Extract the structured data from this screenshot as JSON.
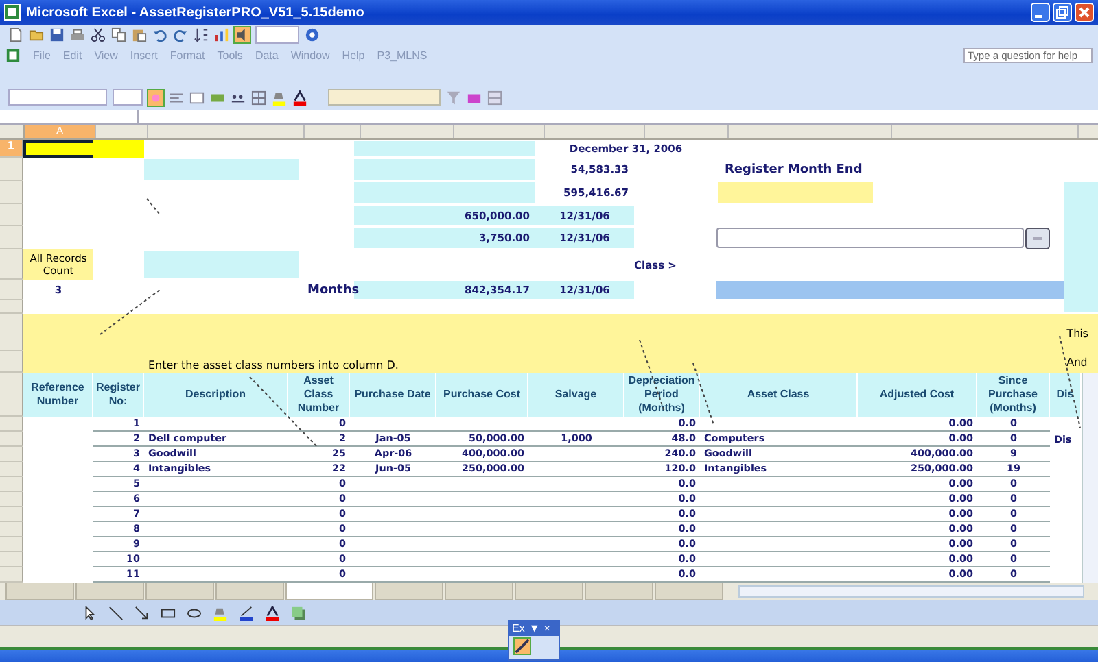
{
  "window": {
    "title": "Microsoft Excel - AssetRegisterPRO_V51_5.15demo"
  },
  "menu": [
    "File",
    "Edit",
    "View",
    "Insert",
    "Format",
    "Tools",
    "Data",
    "Window",
    "Help",
    "P3_MLNS"
  ],
  "help_search": {
    "placeholder": "Type a question for help"
  },
  "column_headers": [
    {
      "label": "A",
      "selected": true
    }
  ],
  "row_headers": [
    {
      "label": "1",
      "selected": true
    }
  ],
  "summary": {
    "report_date": "December 31, 2006",
    "amount_1": "54,583.33",
    "amount_2": "595,416.67",
    "amount_3": "650,000.00",
    "date_3": "12/31/06",
    "amount_4": "3,750.00",
    "date_4": "12/31/06",
    "records_label": "All Records Count",
    "records_count": "3",
    "months_label": "Months",
    "amount_5": "842,354.17",
    "date_5": "12/31/06",
    "month_end_label": "Register Month End",
    "class_label": "Class >",
    "instruction": "Enter the asset class numbers into column D.",
    "note_1": "This",
    "note_2": "And"
  },
  "table": {
    "columns": [
      "Reference Number",
      "Register No:",
      "Description",
      "Asset Class Number",
      "Purchase Date",
      "Purchase Cost",
      "Salvage",
      "Depreciation Period (Months)",
      "Asset Class",
      "Adjusted Cost",
      "Since Purchase (Months)",
      "Dis"
    ],
    "rows": [
      {
        "register": "1",
        "class_number": "0",
        "period": "0.0",
        "adjusted_cost": "0.00",
        "since_purchase": "0"
      },
      {
        "register": "2",
        "description": "Dell computer",
        "class_number": "2",
        "purchase_date": "Jan-05",
        "purchase_cost": "50,000.00",
        "salvage": "1,000",
        "period": "48.0",
        "asset_class": "Computers",
        "adjusted_cost": "0.00",
        "since_purchase": "0",
        "column_12": "Dis"
      },
      {
        "register": "3",
        "description": "Goodwill",
        "class_number": "25",
        "purchase_date": "Apr-06",
        "purchase_cost": "400,000.00",
        "period": "240.0",
        "asset_class": "Goodwill",
        "adjusted_cost": "400,000.00",
        "since_purchase": "9"
      },
      {
        "register": "4",
        "description": "Intangibles",
        "class_number": "22",
        "purchase_date": "Jun-05",
        "purchase_cost": "250,000.00",
        "period": "120.0",
        "asset_class": "Intangibles",
        "adjusted_cost": "250,000.00",
        "since_purchase": "19"
      },
      {
        "register": "5",
        "class_number": "0",
        "period": "0.0",
        "adjusted_cost": "0.00",
        "since_purchase": "0"
      },
      {
        "register": "6",
        "class_number": "0",
        "period": "0.0",
        "adjusted_cost": "0.00",
        "since_purchase": "0"
      },
      {
        "register": "7",
        "class_number": "0",
        "period": "0.0",
        "adjusted_cost": "0.00",
        "since_purchase": "0"
      },
      {
        "register": "8",
        "class_number": "0",
        "period": "0.0",
        "adjusted_cost": "0.00",
        "since_purchase": "0"
      },
      {
        "register": "9",
        "class_number": "0",
        "period": "0.0",
        "adjusted_cost": "0.00",
        "since_purchase": "0"
      },
      {
        "register": "10",
        "class_number": "0",
        "period": "0.0",
        "adjusted_cost": "0.00",
        "since_purchase": "0"
      },
      {
        "register": "11",
        "class_number": "0",
        "period": "0.0",
        "adjusted_cost": "0.00",
        "since_purchase": "0"
      }
    ]
  },
  "sheet_tabs": [
    {
      "selected": false
    },
    {
      "selected": false
    },
    {
      "selected": false
    },
    {
      "selected": false
    },
    {
      "selected": true
    },
    {
      "selected": false
    },
    {
      "selected": false
    },
    {
      "selected": false
    },
    {
      "selected": false
    },
    {
      "selected": false
    }
  ],
  "floating_toolbar": {
    "title": "Ex",
    "menu_glyph": "▼",
    "close_glyph": "×"
  }
}
